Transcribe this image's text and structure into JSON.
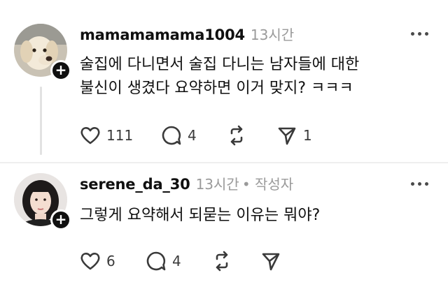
{
  "posts": [
    {
      "username": "mamamamama1004",
      "time": "13시간",
      "author_tag": "",
      "lines": [
        "술집에 다니면서 술집 다니는 남자들에 대한",
        "불신이 생겼다  요약하면 이거 맞지? ㅋㅋㅋ"
      ],
      "likes": "111",
      "comments": "4",
      "shares": "1",
      "avatar": "dog-photo"
    },
    {
      "username": "serene_da_30",
      "time": "13시간",
      "author_tag": "• 작성자",
      "lines": [
        "그렇게 요약해서 되묻는 이유는 뭐야?"
      ],
      "likes": "6",
      "comments": "4",
      "shares": "",
      "avatar": "woman-photo"
    }
  ],
  "icons": {
    "follow": "+",
    "like": "heart-icon",
    "comment": "comment-icon",
    "repost": "repost-icon",
    "share": "send-icon",
    "more": "more-icon"
  },
  "colors": {
    "text": "#101010",
    "muted": "#9a9a9a",
    "thread_line": "#e2e2e2"
  }
}
